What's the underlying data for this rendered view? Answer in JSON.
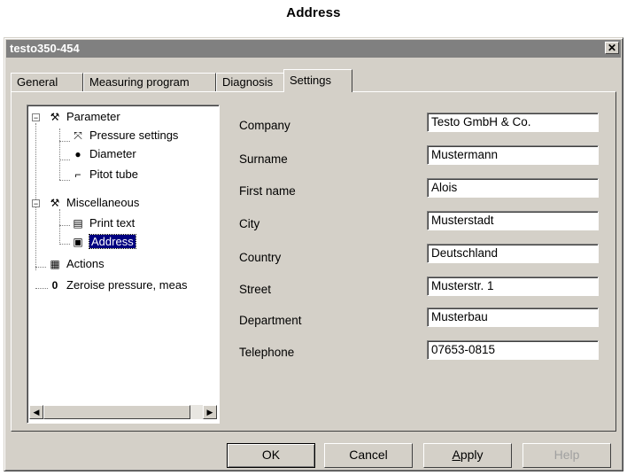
{
  "caption": "Address",
  "window": {
    "title": "testo350-454",
    "close_icon": "✕"
  },
  "tabs": [
    {
      "label": "General"
    },
    {
      "label": "Measuring program"
    },
    {
      "label": "Diagnosis"
    },
    {
      "label": "Settings",
      "active": true
    }
  ],
  "tree": {
    "items": [
      {
        "label": "Parameter",
        "icon": "tools-icon"
      },
      {
        "label": "Pressure settings",
        "icon": "pressure-icon"
      },
      {
        "label": "Diameter",
        "icon": "diameter-icon"
      },
      {
        "label": "Pitot tube",
        "icon": "pitot-tube-icon"
      },
      {
        "label": "Miscellaneous",
        "icon": "hammer-icon"
      },
      {
        "label": "Print text",
        "icon": "document-icon"
      },
      {
        "label": "Address",
        "icon": "address-icon",
        "selected": true
      },
      {
        "label": "Actions",
        "icon": "actions-icon"
      },
      {
        "label": "Zeroise pressure, meas",
        "icon": "zero-icon"
      }
    ]
  },
  "form": {
    "company_label": "Company",
    "company_value": "Testo GmbH & Co.",
    "surname_label": "Surname",
    "surname_value": "Mustermann",
    "firstname_label": "First name",
    "firstname_value": "Alois",
    "city_label": "City",
    "city_value": "Musterstadt",
    "country_label": "Country",
    "country_value": "Deutschland",
    "street_label": "Street",
    "street_value": "Musterstr. 1",
    "department_label": "Department",
    "department_value": "Musterbau",
    "telephone_label": "Telephone",
    "telephone_value": "07653-0815"
  },
  "buttons": {
    "ok": "OK",
    "cancel": "Cancel",
    "apply_first": "A",
    "apply_rest": "pply",
    "help": "Help"
  }
}
